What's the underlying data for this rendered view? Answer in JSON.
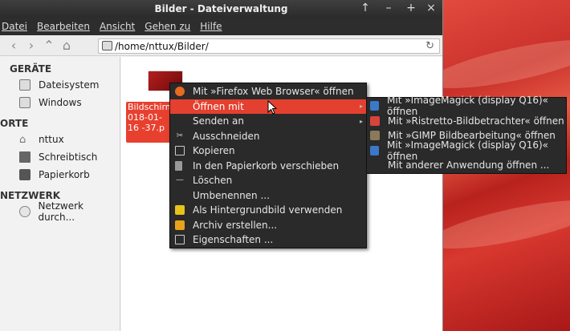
{
  "window": {
    "title": "Bilder - Dateiverwaltung"
  },
  "titlebar_controls": [
    "↑",
    "–",
    "+",
    "×"
  ],
  "menubar": [
    "Datei",
    "Bearbeiten",
    "Ansicht",
    "Gehen zu",
    "Hilfe"
  ],
  "toolbar": {
    "path": "/home/nttux/Bilder/"
  },
  "sidebar": {
    "sections": [
      {
        "title": "GERÄTE",
        "items": [
          {
            "label": "Dateisystem",
            "icon": "drive-icon"
          },
          {
            "label": "Windows",
            "icon": "drive-icon"
          }
        ]
      },
      {
        "title": "ORTE",
        "items": [
          {
            "label": "nttux",
            "icon": "home-icon"
          },
          {
            "label": "Schreibtisch",
            "icon": "desktop-icon"
          },
          {
            "label": "Papierkorb",
            "icon": "trash-icon"
          }
        ]
      },
      {
        "title": "NETZWERK",
        "items": [
          {
            "label": "Netzwerk durch...",
            "icon": "network-icon"
          }
        ]
      }
    ]
  },
  "file": {
    "label": "Bildschirm 018-01-16 -37.p"
  },
  "context_menu": [
    "Mit »Firefox Web Browser« öffnen",
    "Öffnen mit",
    "Senden an",
    "Ausschneiden",
    "Kopieren",
    "In den Papierkorb verschieben",
    "Löschen",
    "Umbenennen ...",
    "Als Hintergrundbild verwenden",
    "Archiv erstellen...",
    "Eigenschaften ..."
  ],
  "submenu": [
    "Mit »ImageMagick (display Q16)« öffnen",
    "Mit »Ristretto-Bildbetrachter« öffnen",
    "Mit »GIMP Bildbearbeitung« öffnen",
    "Mit »ImageMagick (display Q16)« öffnen",
    "Mit anderer Anwendung öffnen ..."
  ]
}
